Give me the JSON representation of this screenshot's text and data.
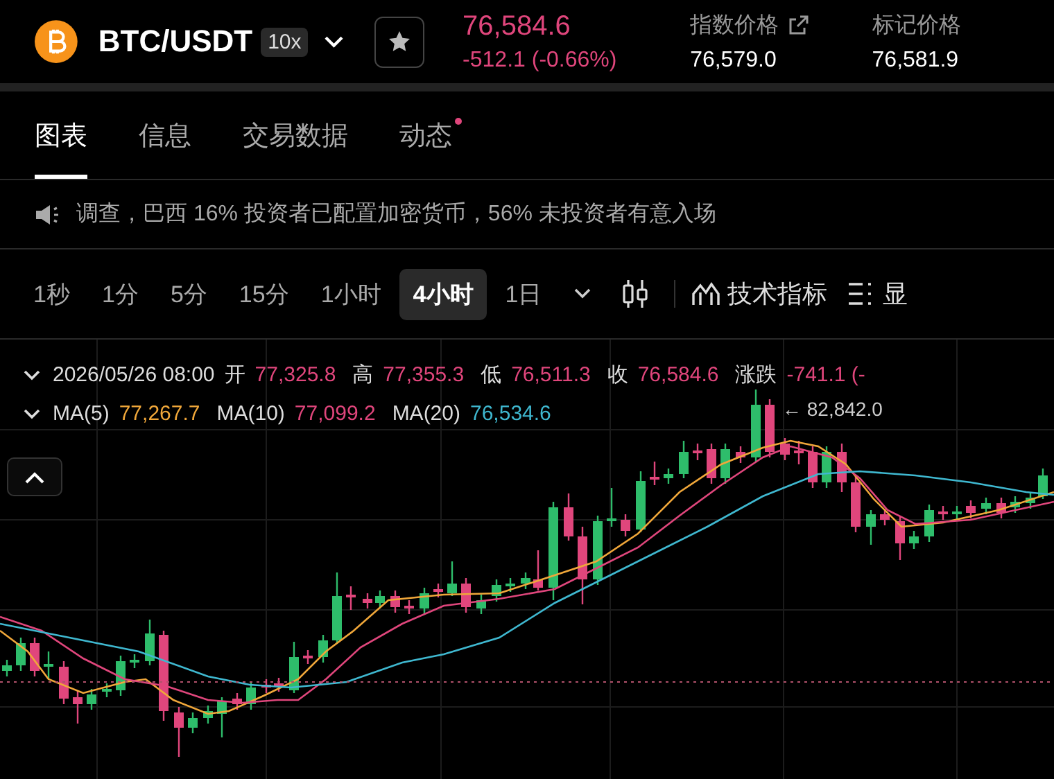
{
  "header": {
    "symbol": "BTC/USDT",
    "leverage": "10x",
    "last_price": "76,584.6",
    "change": "-512.1 (-0.66%)",
    "stats": [
      {
        "label": "指数价格",
        "value": "76,579.0",
        "external_link": true
      },
      {
        "label": "标记价格",
        "value": "76,581.9",
        "external_link": false
      }
    ]
  },
  "tabs": [
    {
      "label": "图表",
      "selected": true,
      "notification_dot": false
    },
    {
      "label": "信息",
      "selected": false,
      "notification_dot": false
    },
    {
      "label": "交易数据",
      "selected": false,
      "notification_dot": false
    },
    {
      "label": "动态",
      "selected": false,
      "notification_dot": true
    }
  ],
  "notice": {
    "text": "调查，巴西 16% 投资者已配置加密货币，56% 未投资者有意入场"
  },
  "timeframes": [
    {
      "label": "1秒",
      "selected": false
    },
    {
      "label": "1分",
      "selected": false
    },
    {
      "label": "5分",
      "selected": false
    },
    {
      "label": "15分",
      "selected": false
    },
    {
      "label": "1小时",
      "selected": false
    },
    {
      "label": "4小时",
      "selected": true
    },
    {
      "label": "1日",
      "selected": false
    }
  ],
  "tools": [
    {
      "kind": "indicators",
      "label": "技术指标"
    },
    {
      "kind": "display",
      "label": "显"
    }
  ],
  "legend": {
    "datetime": "2026/05/26 08:00",
    "ohlc": [
      {
        "label": "开",
        "value": "77,325.8"
      },
      {
        "label": "高",
        "value": "77,355.3"
      },
      {
        "label": "低",
        "value": "76,511.3"
      },
      {
        "label": "收",
        "value": "76,584.6"
      },
      {
        "label": "涨跌",
        "value": "-741.1 (-"
      }
    ],
    "moving_averages": [
      {
        "name": "MA(5)",
        "value": "77,267.7",
        "color": "#f0a73a"
      },
      {
        "name": "MA(10)",
        "value": "77,099.2",
        "color": "#e0467c"
      },
      {
        "name": "MA(20)",
        "value": "76,534.6",
        "color": "#3fb8d0"
      }
    ]
  },
  "chart": {
    "high_label": "← 82,842.0"
  }
}
